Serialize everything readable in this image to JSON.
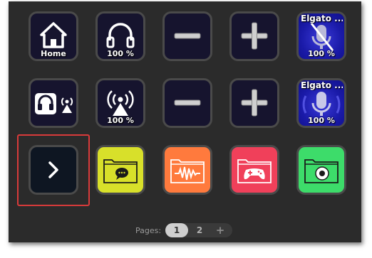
{
  "keys": {
    "home": {
      "label": "Home",
      "icon": "home-icon"
    },
    "headphones_volume": {
      "label": "100 %",
      "icon": "headphones-icon"
    },
    "minus_row1": {
      "icon": "minus-icon"
    },
    "plus_row1": {
      "icon": "plus-icon"
    },
    "elgato_mic_row1": {
      "title": "Elgato ...",
      "label": "100 %",
      "icon": "microphone-muted-icon"
    },
    "headphones_stream": {
      "icon": "headphones-broadcast-icon"
    },
    "broadcast_volume": {
      "label": "100 %",
      "icon": "broadcast-icon"
    },
    "minus_row2": {
      "icon": "minus-icon"
    },
    "plus_row2": {
      "icon": "plus-icon"
    },
    "elgato_mic_row2": {
      "title": "Elgato ...",
      "label": "100 %",
      "icon": "microphone-icon"
    },
    "next_page": {
      "icon": "chevron-right-icon"
    },
    "folder_chat": {
      "icon": "folder-chat-icon",
      "color": "#d8e02a"
    },
    "folder_audio": {
      "icon": "folder-waveform-icon",
      "color": "#ff7a3d"
    },
    "folder_game": {
      "icon": "folder-gamepad-icon",
      "color": "#f0405a"
    },
    "folder_camera": {
      "icon": "folder-lens-icon",
      "color": "#3ddc6a"
    }
  },
  "pagination": {
    "label": "Pages:",
    "pages": [
      "1",
      "2"
    ],
    "active": "1",
    "add": "+"
  },
  "colors": {
    "panel": "#2b2b2b",
    "key_bg": "#16142e",
    "selection": "#d83a3a"
  }
}
